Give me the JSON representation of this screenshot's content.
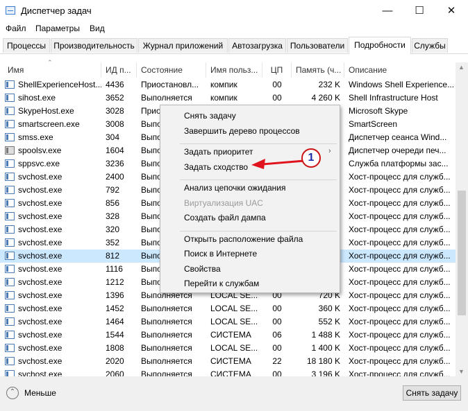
{
  "window": {
    "title": "Диспетчер задач",
    "minimize": "—",
    "maximize": "☐",
    "close": "✕"
  },
  "menu": [
    "Файл",
    "Параметры",
    "Вид"
  ],
  "tabs": [
    "Процессы",
    "Производительность",
    "Журнал приложений",
    "Автозагрузка",
    "Пользователи",
    "Подробности",
    "Службы"
  ],
  "active_tab": "Подробности",
  "columns": [
    "Имя",
    "ИД п...",
    "Состояние",
    "Имя польз...",
    "ЦП",
    "Память (ч...",
    "Описание"
  ],
  "rows": [
    {
      "name": "ShellExperienceHost...",
      "pid": "4436",
      "state": "Приостановл...",
      "user": "компик",
      "cpu": "00",
      "mem": "232 K",
      "desc": "Windows Shell Experience..."
    },
    {
      "name": "sihost.exe",
      "pid": "3652",
      "state": "Выполняется",
      "user": "компик",
      "cpu": "00",
      "mem": "4 260 K",
      "desc": "Shell Infrastructure Host"
    },
    {
      "name": "SkypeHost.exe",
      "pid": "3028",
      "state": "Приос",
      "user": "",
      "cpu": "",
      "mem": "",
      "desc": "Microsoft Skype"
    },
    {
      "name": "smartscreen.exe",
      "pid": "3008",
      "state": "Выпо",
      "user": "",
      "cpu": "",
      "mem": "",
      "desc": "SmartScreen"
    },
    {
      "name": "smss.exe",
      "pid": "304",
      "state": "Выпо",
      "user": "",
      "cpu": "",
      "mem": "",
      "desc": "Диспетчер сеанса  Wind..."
    },
    {
      "name": "spoolsv.exe",
      "pid": "1604",
      "state": "Выпо",
      "user": "",
      "cpu": "",
      "mem": "",
      "desc": "Диспетчер очереди печ...",
      "icon": "printer"
    },
    {
      "name": "sppsvc.exe",
      "pid": "3236",
      "state": "Выпо",
      "user": "",
      "cpu": "",
      "mem": "",
      "desc": "Служба платформы зас..."
    },
    {
      "name": "svchost.exe",
      "pid": "2400",
      "state": "Выпо",
      "user": "",
      "cpu": "",
      "mem": "",
      "desc": "Хост-процесс для служб..."
    },
    {
      "name": "svchost.exe",
      "pid": "792",
      "state": "Выпо",
      "user": "",
      "cpu": "",
      "mem": "",
      "desc": "Хост-процесс для служб..."
    },
    {
      "name": "svchost.exe",
      "pid": "856",
      "state": "Выпо",
      "user": "",
      "cpu": "",
      "mem": "",
      "desc": "Хост-процесс для служб..."
    },
    {
      "name": "svchost.exe",
      "pid": "328",
      "state": "Выпо",
      "user": "",
      "cpu": "",
      "mem": "",
      "desc": "Хост-процесс для служб..."
    },
    {
      "name": "svchost.exe",
      "pid": "320",
      "state": "Выпо",
      "user": "",
      "cpu": "",
      "mem": "",
      "desc": "Хост-процесс для служб..."
    },
    {
      "name": "svchost.exe",
      "pid": "352",
      "state": "Выпо",
      "user": "",
      "cpu": "",
      "mem": "",
      "desc": "Хост-процесс для служб..."
    },
    {
      "name": "svchost.exe",
      "pid": "812",
      "state": "Выпо",
      "user": "",
      "cpu": "",
      "mem": "",
      "desc": "Хост-процесс для служб...",
      "selected": true
    },
    {
      "name": "svchost.exe",
      "pid": "1116",
      "state": "Выпо",
      "user": "",
      "cpu": "",
      "mem": "",
      "desc": "Хост-процесс для служб..."
    },
    {
      "name": "svchost.exe",
      "pid": "1212",
      "state": "Выпо",
      "user": "",
      "cpu": "",
      "mem": "",
      "desc": "Хост-процесс для служб..."
    },
    {
      "name": "svchost.exe",
      "pid": "1396",
      "state": "Выполняется",
      "user": "LOCAL SE...",
      "cpu": "00",
      "mem": "720 K",
      "desc": "Хост-процесс для служб..."
    },
    {
      "name": "svchost.exe",
      "pid": "1452",
      "state": "Выполняется",
      "user": "LOCAL SE...",
      "cpu": "00",
      "mem": "360 K",
      "desc": "Хост-процесс для служб..."
    },
    {
      "name": "svchost.exe",
      "pid": "1464",
      "state": "Выполняется",
      "user": "LOCAL SE...",
      "cpu": "00",
      "mem": "552 K",
      "desc": "Хост-процесс для служб..."
    },
    {
      "name": "svchost.exe",
      "pid": "1544",
      "state": "Выполняется",
      "user": "СИСТЕМА",
      "cpu": "06",
      "mem": "1 488 K",
      "desc": "Хост-процесс для служб..."
    },
    {
      "name": "svchost.exe",
      "pid": "1808",
      "state": "Выполняется",
      "user": "LOCAL SE...",
      "cpu": "00",
      "mem": "1 400 K",
      "desc": "Хост-процесс для служб..."
    },
    {
      "name": "svchost.exe",
      "pid": "2020",
      "state": "Выполняется",
      "user": "СИСТЕМА",
      "cpu": "22",
      "mem": "18 180 K",
      "desc": "Хост-процесс для служб..."
    },
    {
      "name": "svchost.exe",
      "pid": "2060",
      "state": "Выполняется",
      "user": "СИСТЕМА",
      "cpu": "00",
      "mem": "3 196 K",
      "desc": "Хост-процесс для служб..."
    }
  ],
  "context_menu": {
    "items": [
      {
        "label": "Снять задачу"
      },
      {
        "label": "Завершить дерево процессов"
      },
      {
        "sep": true
      },
      {
        "label": "Задать приоритет",
        "submenu": true
      },
      {
        "label": "Задать сходство"
      },
      {
        "sep": true
      },
      {
        "label": "Анализ цепочки ожидания"
      },
      {
        "label": "Виртуализация UAC",
        "disabled": true
      },
      {
        "label": "Создать файл дампа"
      },
      {
        "sep": true
      },
      {
        "label": "Открыть расположение файла"
      },
      {
        "label": "Поиск в Интернете"
      },
      {
        "label": "Свойства"
      },
      {
        "label": "Перейти к службам"
      }
    ],
    "submenu_arrow": "›"
  },
  "annotation": {
    "badge": "1",
    "color": "#e0141e"
  },
  "footer": {
    "less_label": "Меньше",
    "end_task_label": "Снять задачу"
  }
}
